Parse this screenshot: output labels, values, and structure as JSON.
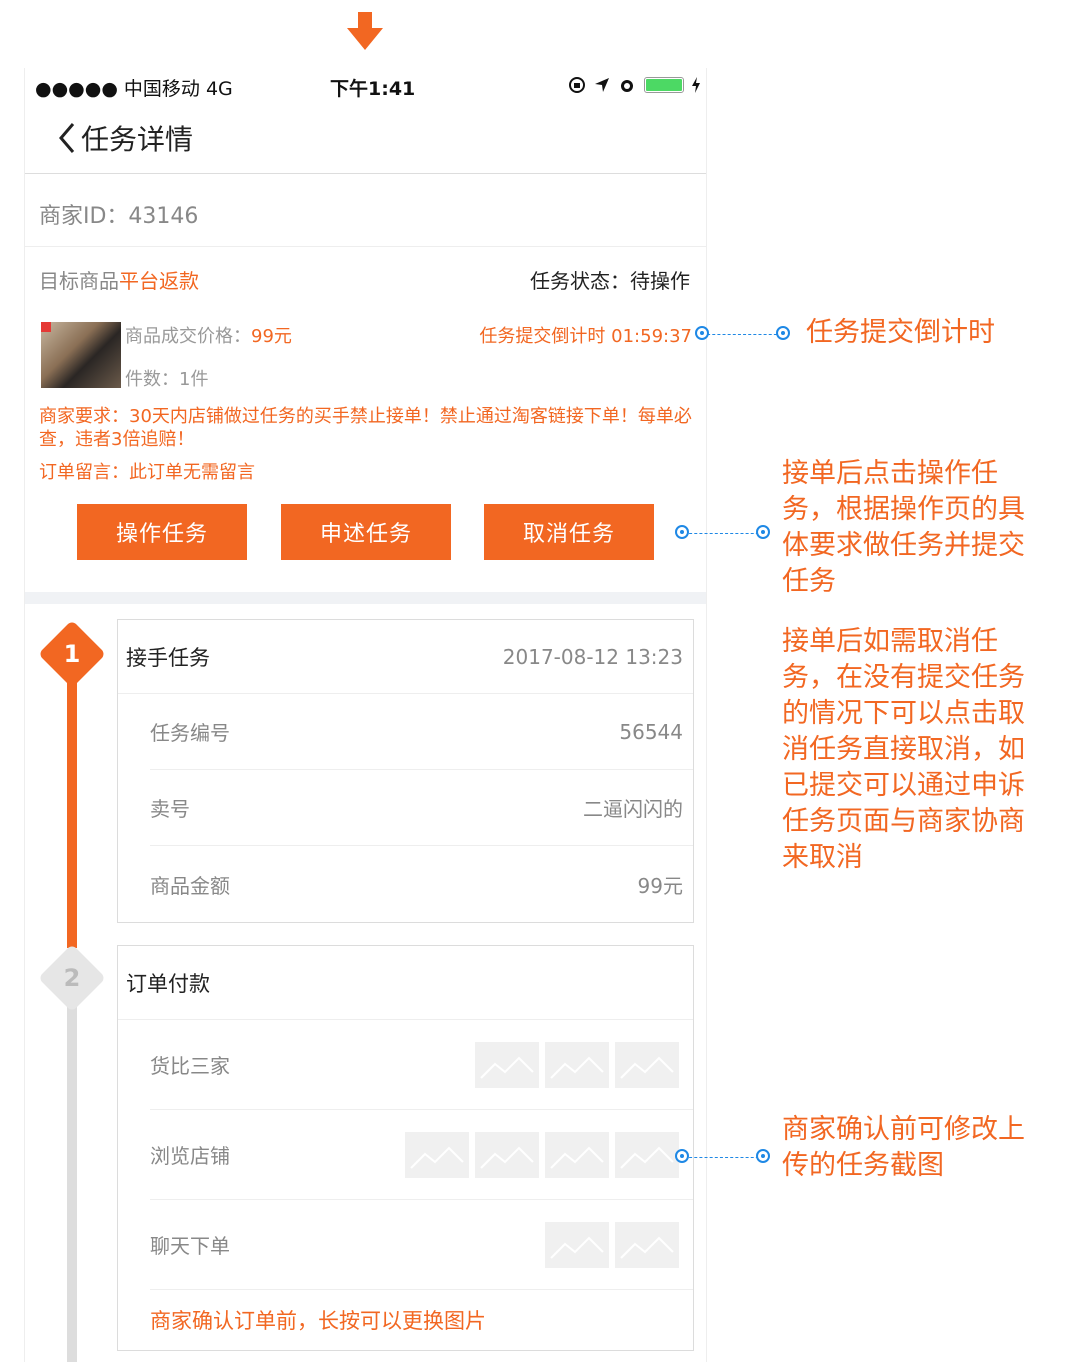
{
  "status_bar": {
    "carrier": "●●●●● 中国移动   4G",
    "time": "下午1:41"
  },
  "nav": {
    "title": "任务详情"
  },
  "merchant": {
    "id_text": "商家ID：43146"
  },
  "target": {
    "label": "目标商品",
    "tag": "平台返款",
    "status_text": "任务状态：待操作"
  },
  "product": {
    "price_label": "商品成交价格：",
    "price_value": "99元",
    "qty_text": "件数：1件",
    "countdown": "任务提交倒计时 01:59:37"
  },
  "requirement": "商家要求：30天内店铺做过任务的买手禁止接单！禁止通过淘客链接下单！每单必查，违者3倍追赔！",
  "order_note": "订单留言：此订单无需留言",
  "buttons": {
    "operate": "操作任务",
    "appeal": "申述任务",
    "cancel": "取消任务"
  },
  "steps": [
    {
      "num": "1",
      "title": "接手任务",
      "date": "2017-08-12 13:23",
      "rows": [
        {
          "label": "任务编号",
          "value": "56544"
        },
        {
          "label": "卖号",
          "value": "二逼闪闪的"
        },
        {
          "label": "商品金额",
          "value": "99元"
        }
      ]
    },
    {
      "num": "2",
      "title": "订单付款",
      "rows": [
        {
          "label": "货比三家",
          "thumbs": 3
        },
        {
          "label": "浏览店铺",
          "thumbs": 4
        },
        {
          "label": "聊天下单",
          "thumbs": 2
        }
      ],
      "footer": "商家确认订单前，长按可以更换图片"
    }
  ],
  "annotations": {
    "countdown": "任务提交倒计时",
    "operate": "接单后点击操作任务，根据操作页的具体要求做任务并提交任务",
    "cancel": "接单后如需取消任务，在没有提交任务的情况下可以点击取消任务直接取消，如已提交可以通过申诉任务页面与商家协商来取消",
    "screenshot": "商家确认前可修改上传的任务截图"
  },
  "colors": {
    "accent": "#f26722",
    "annotation_line": "#1e88e5",
    "inactive": "#dddddd"
  },
  "icons": [
    "down-arrow-icon",
    "back-chevron-icon",
    "lock-rotation-icon",
    "location-icon",
    "alarm-icon",
    "battery-icon",
    "charging-icon",
    "image-placeholder-icon"
  ]
}
